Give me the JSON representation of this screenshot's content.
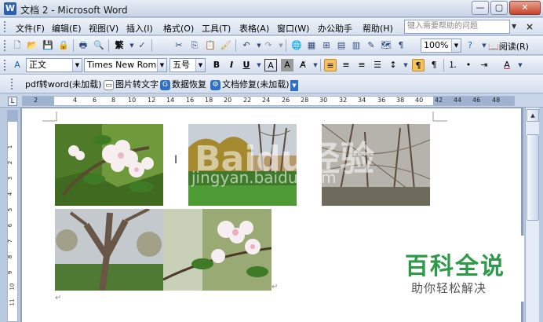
{
  "window": {
    "title": "文档 2 - Microsoft Word",
    "icon_letter": "W",
    "minimize": "—",
    "restore": "▢",
    "close": "✕"
  },
  "menu": {
    "items": [
      "文件(F)",
      "编辑(E)",
      "视图(V)",
      "插入(I)",
      "格式(O)",
      "工具(T)",
      "表格(A)",
      "窗口(W)",
      "办公助手",
      "帮助(H)"
    ],
    "help_placeholder": "键入需要帮助的问题",
    "doc_close": "×"
  },
  "standard_toolbar": {
    "zoom": "100%",
    "reading": "阅读(R)",
    "traditional": "繁"
  },
  "format_toolbar": {
    "style": "正文",
    "font": "Times New Roman",
    "size": "五号",
    "bold": "B",
    "italic": "I",
    "underline": "U",
    "char_border": "A",
    "char_shade": "A",
    "font_color": "A"
  },
  "addin_toolbar": {
    "items": [
      "pdf转word(未加载)",
      "图片转文字",
      "数据恢复",
      "文档修复(未加载)"
    ]
  },
  "ruler": {
    "corner": "L",
    "numbers": [
      "2",
      "2",
      "4",
      "6",
      "8",
      "10",
      "12",
      "14",
      "16",
      "18",
      "20",
      "22",
      "24",
      "26",
      "28",
      "30",
      "32",
      "34",
      "36",
      "38",
      "40",
      "42",
      "44",
      "46",
      "48"
    ],
    "vnumbers": [
      "2",
      "1",
      "2",
      "3",
      "4",
      "5",
      "6",
      "7",
      "8",
      "9",
      "10",
      "11",
      "12",
      "13"
    ]
  },
  "watermark": {
    "baidu": "Baidu经验",
    "url": "jingyan.baidu.com",
    "title": "百科全说",
    "subtitle": "助你轻松解决"
  },
  "colors": {
    "watermark_green": "#2c9a49",
    "title_accent": "#2b5fb3"
  }
}
